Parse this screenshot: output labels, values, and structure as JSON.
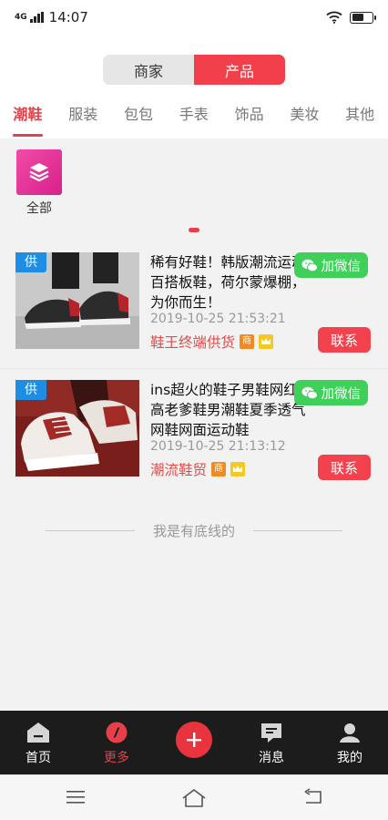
{
  "status_bar": {
    "network": "4G",
    "time": "14:07"
  },
  "header": {
    "segments": [
      {
        "label": "商家",
        "active": false
      },
      {
        "label": "产品",
        "active": true
      }
    ]
  },
  "categories": [
    {
      "label": "潮鞋",
      "active": true
    },
    {
      "label": "服装",
      "active": false
    },
    {
      "label": "包包",
      "active": false
    },
    {
      "label": "手表",
      "active": false
    },
    {
      "label": "饰品",
      "active": false
    },
    {
      "label": "美妆",
      "active": false
    },
    {
      "label": "其他",
      "active": false
    }
  ],
  "quick_grid": {
    "all_label": "全部"
  },
  "listings": [
    {
      "badge": "供",
      "title": "稀有好鞋！韩版潮流运动百搭板鞋，荷尔蒙爆棚，为你而生！",
      "wechat_label": "加微信",
      "time": "2019-10-25 21:53:21",
      "shop_name": "鞋王终端供货",
      "merchant_badge": "商",
      "contact_label": "联系"
    },
    {
      "badge": "供",
      "title": "ins超火的鞋子男鞋网红增高老爹鞋男潮鞋夏季透气网鞋网面运动鞋",
      "wechat_label": "加微信",
      "time": "2019-10-25 21:13:12",
      "shop_name": "潮流鞋贸",
      "merchant_badge": "商",
      "contact_label": "联系"
    }
  ],
  "end_text": "我是有底线的",
  "bottom_nav": [
    {
      "label": "首页",
      "icon": "home-icon",
      "active": false
    },
    {
      "label": "更多",
      "icon": "compass-icon",
      "active": true
    },
    {
      "label": "",
      "icon": "plus-icon",
      "active": false
    },
    {
      "label": "消息",
      "icon": "message-icon",
      "active": false
    },
    {
      "label": "我的",
      "icon": "user-icon",
      "active": false
    }
  ],
  "colors": {
    "accent": "#e8404b",
    "wechat": "#3fd05a",
    "badge_blue": "#1e8ee5",
    "nav_bg": "#1c1c1c"
  }
}
